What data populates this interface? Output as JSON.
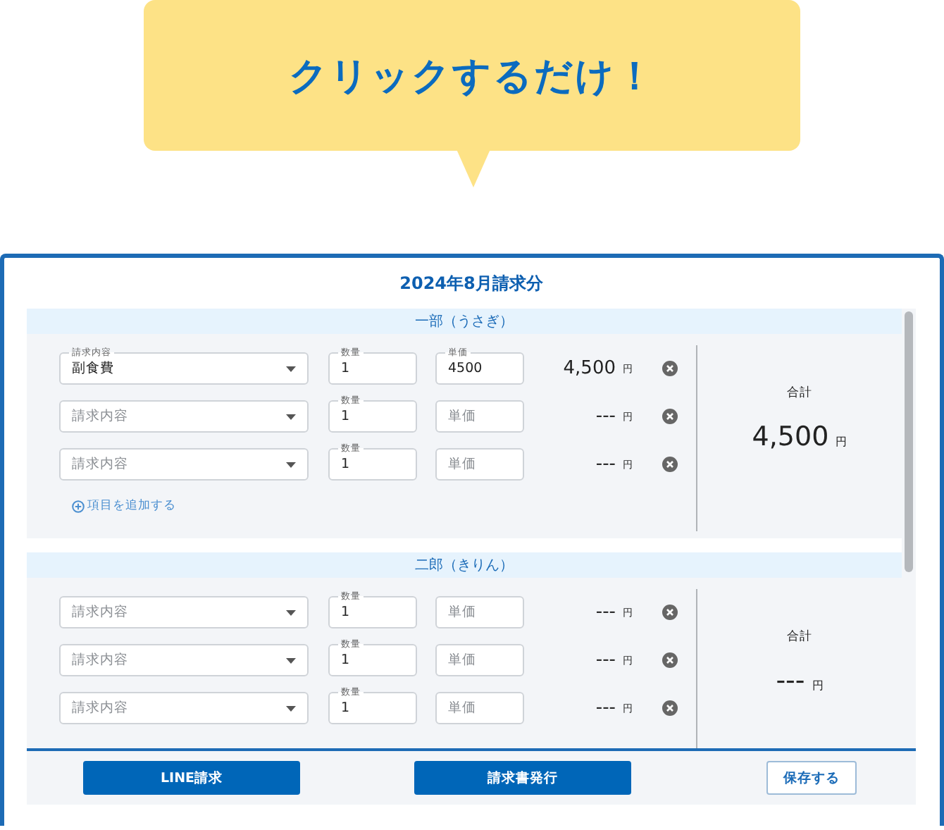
{
  "callout": {
    "text": "クリックするだけ！"
  },
  "window": {
    "title": "2024年8月請求分"
  },
  "sections": [
    {
      "name": "一部（うさぎ）",
      "lines": [
        {
          "item": {
            "label": "請求内容",
            "value": "副食費"
          },
          "quantity": {
            "label": "数量",
            "value": "1"
          },
          "price": {
            "label": "単価",
            "value": "4500"
          },
          "amount": "4,500",
          "unit": "円"
        },
        {
          "item": {
            "placeholder": "請求内容"
          },
          "quantity": {
            "label": "数量",
            "value": "1"
          },
          "price": {
            "placeholder": "単価"
          },
          "amount": "---",
          "unit": "円"
        },
        {
          "item": {
            "placeholder": "請求内容"
          },
          "quantity": {
            "label": "数量",
            "value": "1"
          },
          "price": {
            "placeholder": "単価"
          },
          "amount": "---",
          "unit": "円"
        }
      ],
      "add_label": "項目を追加する",
      "total_label": "合計",
      "total": "4,500",
      "total_unit": "円"
    },
    {
      "name": "二郎（きりん）",
      "lines": [
        {
          "item": {
            "placeholder": "請求内容"
          },
          "quantity": {
            "label": "数量",
            "value": "1"
          },
          "price": {
            "placeholder": "単価"
          },
          "amount": "---",
          "unit": "円"
        },
        {
          "item": {
            "placeholder": "請求内容"
          },
          "quantity": {
            "label": "数量",
            "value": "1"
          },
          "price": {
            "placeholder": "単価"
          },
          "amount": "---",
          "unit": "円"
        },
        {
          "item": {
            "placeholder": "請求内容"
          },
          "quantity": {
            "label": "数量",
            "value": "1"
          },
          "price": {
            "placeholder": "単価"
          },
          "amount": "---",
          "unit": "円"
        }
      ],
      "total_label": "合計",
      "total": "---",
      "total_unit": "円"
    }
  ],
  "buttons": [
    {
      "label": "LINE請求",
      "kind": "primary"
    },
    {
      "label": "請求書発行",
      "kind": "primary"
    },
    {
      "label": "保存する",
      "kind": "outline"
    }
  ]
}
